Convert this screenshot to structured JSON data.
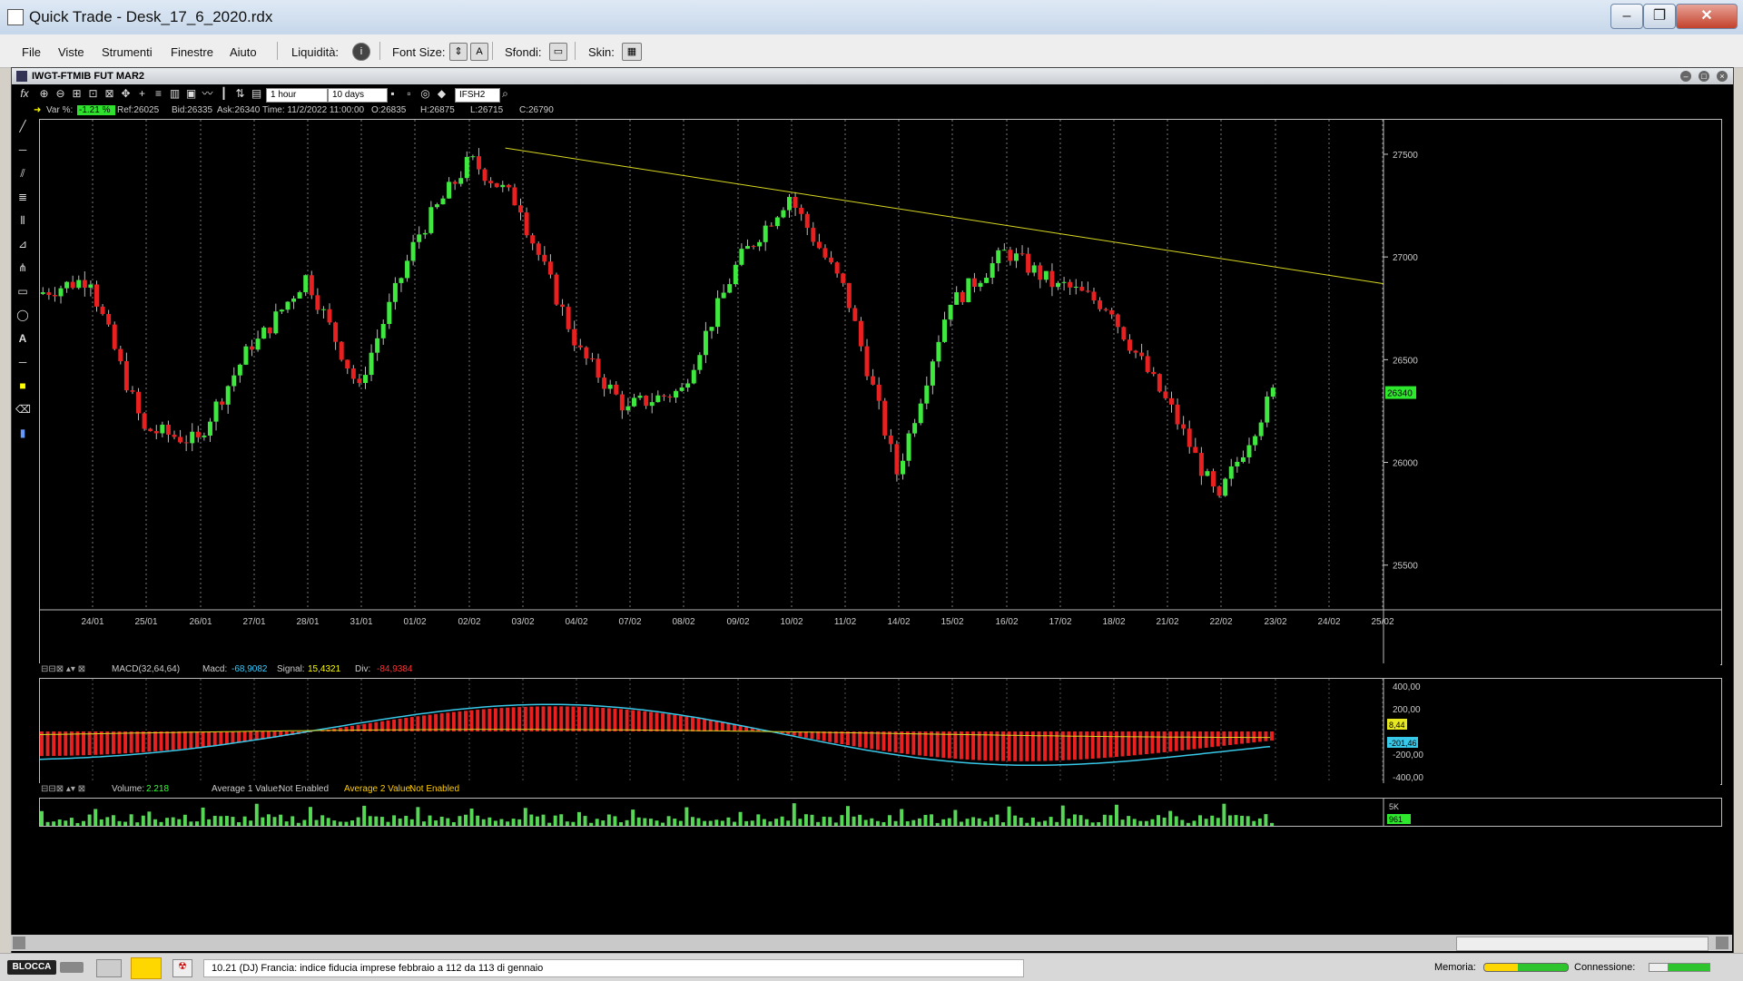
{
  "window": {
    "title": "Quick Trade - Desk_17_6_2020.rdx"
  },
  "menu": {
    "items": [
      "File",
      "Viste",
      "Strumenti",
      "Finestre",
      "Aiuto"
    ],
    "liquidita_label": "Liquidità:",
    "font_size_label": "Font Size:",
    "sfondi_label": "Sfondi:",
    "skin_label": "Skin:"
  },
  "chart_window": {
    "title": "IWGT-FTMIB FUT MAR2",
    "interval": "1 hour",
    "period": "10 days",
    "symbol": "IFSH2",
    "info": {
      "var_label": "Var %:",
      "var_value": "-1.21 %",
      "ref": "Ref:26025",
      "bid": "Bid:26335",
      "ask": "Ask:26340",
      "time": "Time: 11/2/2022 11:00:00",
      "open": "O:26835",
      "high": "H:26875",
      "low": "L:26715",
      "close": "C:26790"
    }
  },
  "chart_data": {
    "type": "candlestick",
    "x_labels": [
      "24/01",
      "25/01",
      "26/01",
      "27/01",
      "28/01",
      "31/01",
      "01/02",
      "02/02",
      "03/02",
      "04/02",
      "07/02",
      "08/02",
      "09/02",
      "10/02",
      "11/02",
      "14/02",
      "15/02",
      "16/02",
      "17/02",
      "18/02",
      "21/02",
      "22/02",
      "23/02",
      "24/02",
      "25/02"
    ],
    "y_ticks": [
      "27500",
      "27000",
      "26500",
      "26000",
      "25500"
    ],
    "y_range": [
      25300,
      27650
    ],
    "last_price": "26340",
    "up_color": "#3ee83e",
    "down_color": "#e82020",
    "trendline_color": "#d8d820",
    "trendline": [
      [
        "02/02",
        27530
      ],
      [
        "25/02",
        26870
      ]
    ],
    "session_closes": [
      26900,
      26150,
      26100,
      26580,
      26900,
      26350,
      27050,
      27450,
      27250,
      26600,
      26250,
      26350,
      26950,
      27300,
      26850,
      25950,
      26800,
      27020,
      26850,
      26750,
      26300,
      25800,
      26340
    ]
  },
  "macd": {
    "label": "MACD(32,64,64)",
    "macd_label": "Macd:",
    "macd_value": "-68,9082",
    "signal_label": "Signal:",
    "signal_value": "15,4321",
    "div_label": "Div:",
    "div_value": "-84,9384",
    "y_ticks": [
      "400,00",
      "200,00",
      "",
      "-200,00",
      "-400,00"
    ],
    "marker_signal": "8,44",
    "marker_macd": "-201,46"
  },
  "volume": {
    "label": "Volume:",
    "value": "2.218",
    "avg1_label": "Average 1 Value:",
    "avg1_value": "Not Enabled",
    "avg2_label": "Average 2 Value:",
    "avg2_value": "Not Enabled",
    "y_ticks": [
      "5K"
    ],
    "marker": "961"
  },
  "status": {
    "blocca": "BLOCCA",
    "news": "10.21 (DJ) Francia: indice fiducia imprese febbraio a 112 da 113 di gennaio",
    "memoria_label": "Memoria:",
    "connessione_label": "Connessione:"
  }
}
